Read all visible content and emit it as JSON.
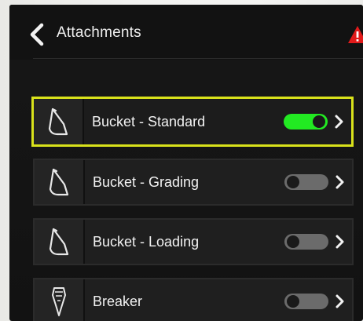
{
  "header": {
    "title": "Attachments",
    "back_icon": "chevron-left-icon",
    "warning_icon": "warning-icon"
  },
  "colors": {
    "selection_border": "#d9e21b",
    "toggle_on": "#22ea22",
    "toggle_off": "#6b6b6b",
    "warning": "#e21b1b"
  },
  "attachments": [
    {
      "label": "Bucket - Standard",
      "icon": "bucket-icon",
      "enabled": true,
      "selected": true
    },
    {
      "label": "Bucket - Grading",
      "icon": "bucket-icon",
      "enabled": false,
      "selected": false
    },
    {
      "label": "Bucket - Loading",
      "icon": "bucket-icon",
      "enabled": false,
      "selected": false
    },
    {
      "label": "Breaker",
      "icon": "breaker-icon",
      "enabled": false,
      "selected": false
    }
  ]
}
